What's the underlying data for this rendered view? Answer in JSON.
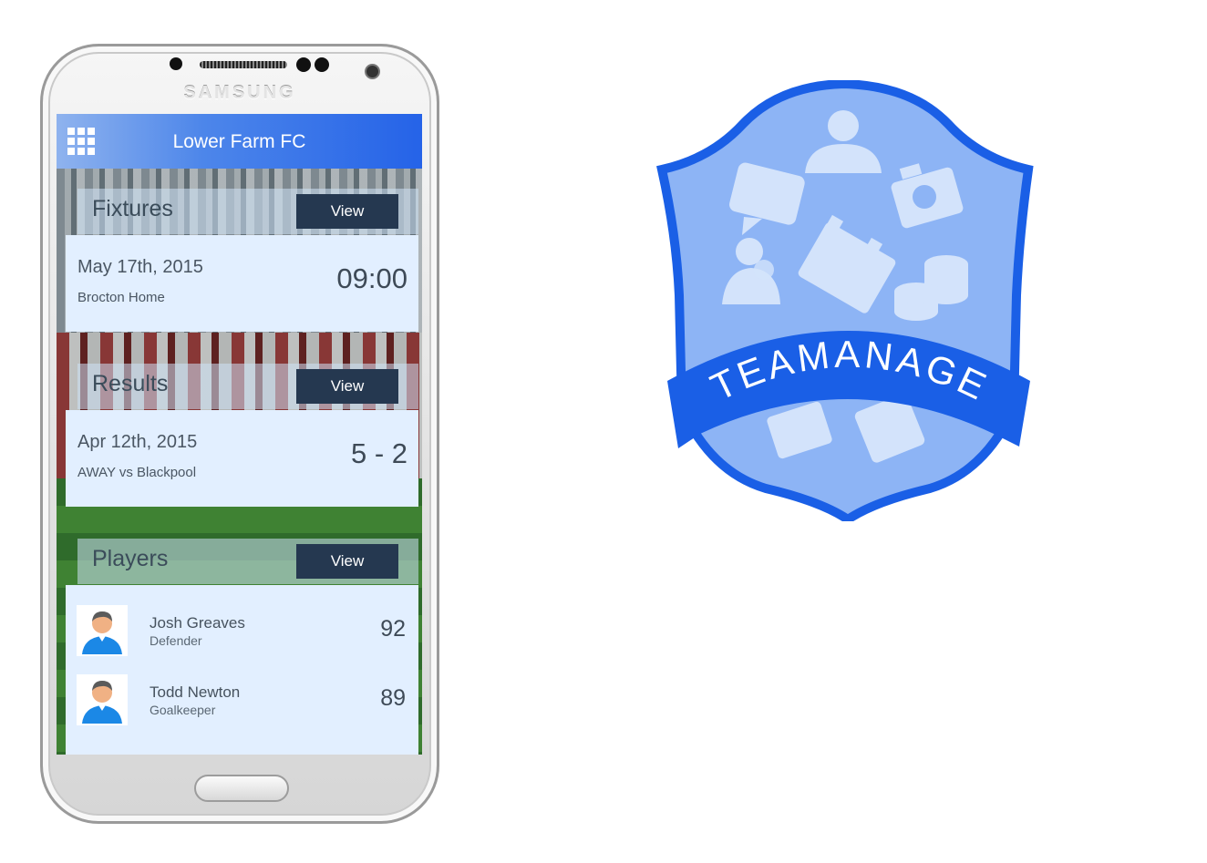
{
  "device": {
    "brand_text": "SAMSUNG"
  },
  "app": {
    "title": "Lower Farm FC",
    "fixtures": {
      "heading": "Fixtures",
      "view_label": "View",
      "date": "May 17th, 2015",
      "detail": "Brocton Home",
      "time": "09:00"
    },
    "results": {
      "heading": "Results",
      "view_label": "View",
      "date": "Apr 12th, 2015",
      "detail": "AWAY vs Blackpool",
      "score": "5 - 2"
    },
    "players": {
      "heading": "Players",
      "view_label": "View",
      "list": [
        {
          "name": "Josh Greaves",
          "position": "Defender",
          "rating": "92"
        },
        {
          "name": "Todd Newton",
          "position": "Goalkeeper",
          "rating": "89"
        }
      ]
    }
  },
  "logo": {
    "text": "TEAMANAGE"
  },
  "colors": {
    "accent": "#2563e8",
    "button": "#253850",
    "card": "#e2efff",
    "shield": "#1a5fe6"
  }
}
